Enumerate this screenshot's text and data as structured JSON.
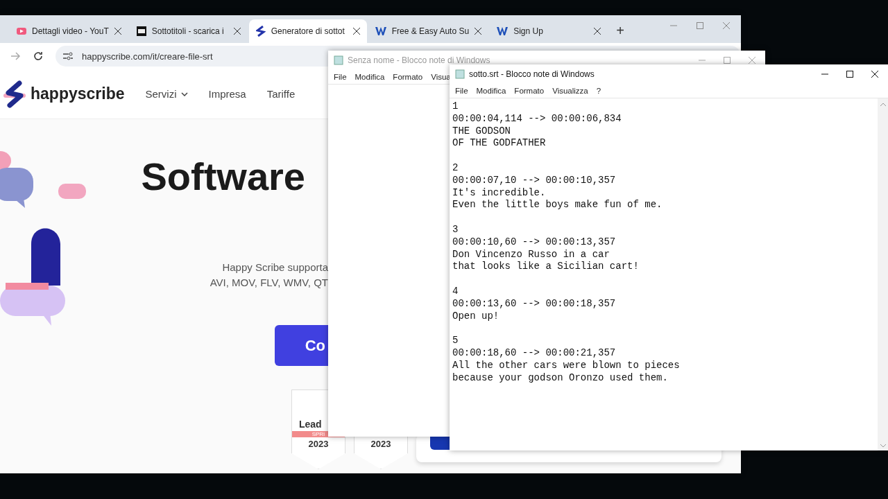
{
  "browser": {
    "tabs": [
      {
        "title": "Dettagli video - YouT",
        "kind": "video",
        "selected": false
      },
      {
        "title": "Sottotitoli - scarica i",
        "kind": "film",
        "selected": false
      },
      {
        "title": "Generatore di sottot",
        "kind": "brand",
        "selected": true
      },
      {
        "title": "Free & Easy Auto Su",
        "kind": "w",
        "selected": false
      },
      {
        "title": "Sign Up",
        "kind": "w",
        "selected": false
      }
    ],
    "new_tab": "+",
    "url": "happyscribe.com/it/creare-file-srt",
    "page": {
      "logo": "happyscribe",
      "nav": [
        {
          "label": "Servizi",
          "dropdown": true
        },
        {
          "label": "Impresa",
          "dropdown": false
        },
        {
          "label": "Tariffe",
          "dropdown": false
        }
      ],
      "heading": "Software",
      "subtitle": [
        "Happy Scribe supporta",
        "AVI, MOV, FLV, WMV, QT"
      ],
      "cta": "Co",
      "badges": [
        {
          "title": "Lead",
          "ribbon": "SPRI",
          "year": "2023"
        },
        {
          "year": "2023"
        }
      ]
    }
  },
  "notepad_back": {
    "title": "Senza nome - Blocco note di Windows",
    "menu": [
      "File",
      "Modifica",
      "Formato",
      "Visua"
    ]
  },
  "notepad_front": {
    "title": "sotto.srt - Blocco note di Windows",
    "menu": [
      "File",
      "Modifica",
      "Formato",
      "Visualizza",
      "?"
    ],
    "subtitles": [
      {
        "index": "1",
        "time": "00:00:04,114 --> 00:00:06,834",
        "lines": [
          "THE GODSON",
          "OF THE GODFATHER"
        ]
      },
      {
        "index": "2",
        "time": "00:00:07,10 --> 00:00:10,357",
        "lines": [
          "It's incredible.",
          "Even the little boys make fun of me."
        ]
      },
      {
        "index": "3",
        "time": "00:00:10,60 --> 00:00:13,357",
        "lines": [
          "Don Vincenzo Russo in a car",
          "that looks like a Sicilian cart!"
        ]
      },
      {
        "index": "4",
        "time": "00:00:13,60 --> 00:00:18,357",
        "lines": [
          "Open up!"
        ]
      },
      {
        "index": "5",
        "time": "00:00:18,60 --> 00:00:21,357",
        "lines": [
          "All the other cars were blown to pieces",
          "because your godson Oronzo used them."
        ]
      }
    ]
  }
}
